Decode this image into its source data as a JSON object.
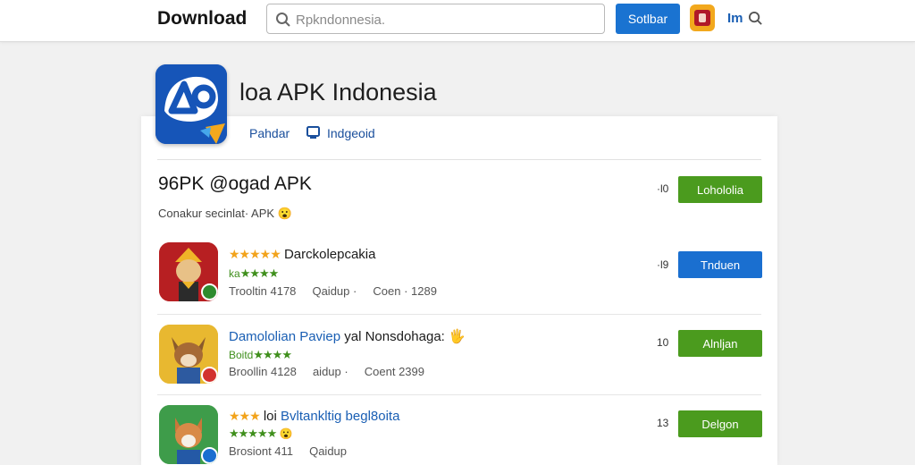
{
  "topbar": {
    "brand": "Download",
    "search_placeholder": "Rpkndonnesia.",
    "search_button": "Sotlbar",
    "lang": "Im"
  },
  "app": {
    "title": "loa APK Indonesia",
    "tabs": [
      "Pahdar",
      "Indgeoid"
    ]
  },
  "section": {
    "title": "96PK @ogad APK",
    "subtitle": "Conakur secinlat· APK",
    "subtitle_emoji": "😮",
    "count": "·l0",
    "button": "Lohololia"
  },
  "items": [
    {
      "stars": "★★★★★",
      "name": "Darckolepcakia",
      "rating_label": "ka",
      "rating_stars": "★★★★",
      "meta_a": "Trooltin 4178",
      "meta_b": "Qaidup ·",
      "meta_c": "Coen · 1289",
      "count": "·l9",
      "button": "Tnduen",
      "button_color": "#1a6fd0"
    },
    {
      "name_blue": "Damololian Paviep",
      "name_dark": "yal Nonsdohaga:",
      "name_icon": "🖐",
      "rating_label": "Boitd",
      "rating_stars": "★★★★",
      "meta_a": "Broollin 4128",
      "meta_b": "aidup ·",
      "meta_c": "Coent 2399",
      "count": "10",
      "button": "Alnljan",
      "button_color": "#4b9b1e"
    },
    {
      "stars": "★★★",
      "name_dark": "loi",
      "name_blue": "Bvltankltig begl8oita",
      "rating_stars": "★★★★★",
      "rating_emoji": "😮",
      "meta_a": "Brosiont 411",
      "meta_b": "Qaidup",
      "count": "13",
      "button": "Delgon",
      "button_color": "#4b9b1e"
    }
  ],
  "colors": {
    "accent_blue": "#1a73d1",
    "accent_green": "#4b9b1e",
    "star_gold": "#f2a31b"
  }
}
